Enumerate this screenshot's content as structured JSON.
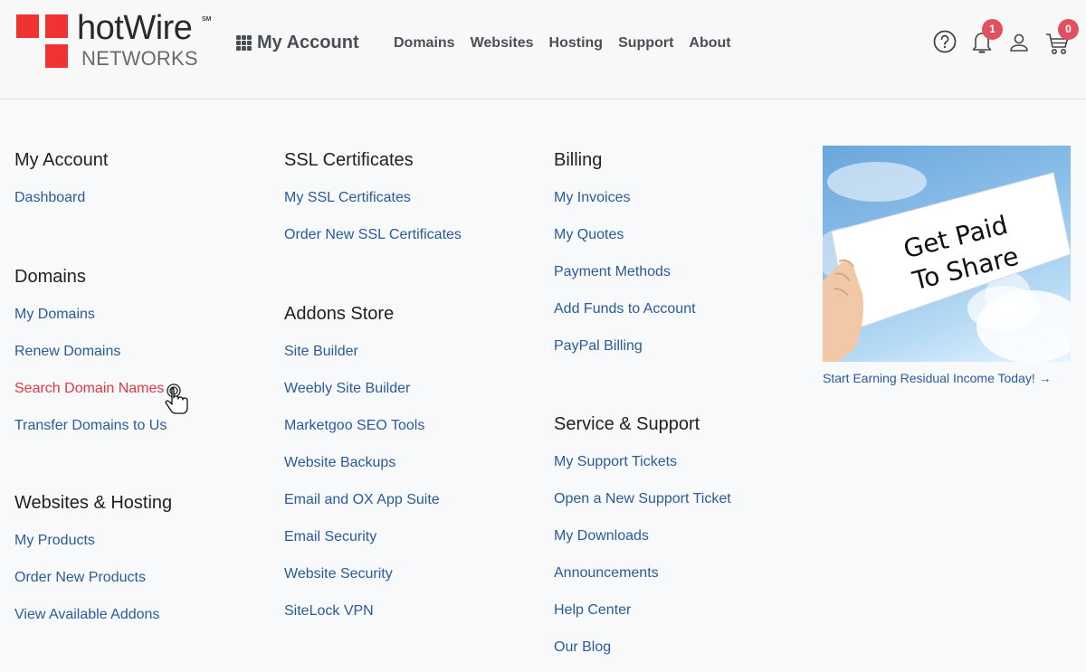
{
  "header": {
    "logo": {
      "brand": "hotWire",
      "sub": "NETWORKS",
      "mark": "SM"
    },
    "my_account": {
      "icon": "grid-icon",
      "label": "My Account"
    },
    "nav": [
      "Domains",
      "Websites",
      "Hosting",
      "Support",
      "About"
    ],
    "icons": {
      "help": {
        "icon": "help-circle-icon"
      },
      "notifications": {
        "icon": "bell-icon",
        "badge": "1"
      },
      "account": {
        "icon": "user-icon"
      },
      "cart": {
        "icon": "cart-icon",
        "badge": "0"
      }
    },
    "colors": {
      "brand_red": "#f03232",
      "badge": "#e0505e",
      "link": "#2a5b9a",
      "active_link": "#e0393e"
    }
  },
  "menu": {
    "my_account": {
      "title": "My Account",
      "items": [
        "Dashboard"
      ]
    },
    "domains": {
      "title": "Domains",
      "items": [
        "My Domains",
        "Renew Domains",
        "Search Domain Names",
        "Transfer Domains to Us"
      ],
      "active_index": 2
    },
    "websites_hosting": {
      "title": "Websites & Hosting",
      "items": [
        "My Products",
        "Order New Products",
        "View Available Addons"
      ]
    },
    "ssl": {
      "title": "SSL Certificates",
      "items": [
        "My SSL Certificates",
        "Order New SSL Certificates"
      ]
    },
    "addons": {
      "title": "Addons Store",
      "items": [
        "Site Builder",
        "Weebly Site Builder",
        "Marketgoo SEO Tools",
        "Website Backups",
        "Email and OX App Suite",
        "Email Security",
        "Website Security",
        "SiteLock VPN"
      ]
    },
    "billing": {
      "title": "Billing",
      "items": [
        "My Invoices",
        "My Quotes",
        "Payment Methods",
        "Add Funds to Account",
        "PayPal Billing"
      ]
    },
    "support": {
      "title": "Service & Support",
      "items": [
        "My Support Tickets",
        "Open a New Support Ticket",
        "My Downloads",
        "Announcements",
        "Help Center",
        "Our Blog"
      ]
    }
  },
  "promo": {
    "image_text_line1": "Get Paid",
    "image_text_line2": "To Share",
    "link": "Start Earning Residual Income Today! →"
  }
}
